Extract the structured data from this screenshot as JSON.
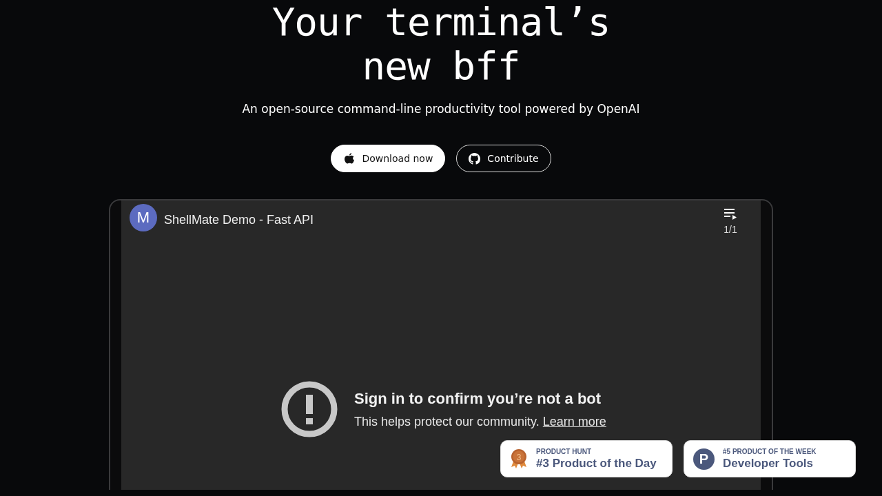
{
  "hero": {
    "title_lines": [
      "Your terminal’s",
      "new bff"
    ],
    "subtitle": "An open-source command-line productivity tool powered by OpenAI"
  },
  "buttons": [
    {
      "kind": "primary",
      "label": "Download now"
    },
    {
      "kind": "outline",
      "label": "Contribute"
    }
  ],
  "video": {
    "avatar_letter": "M",
    "title": "ShellMate Demo - Fast API",
    "playlist_count": "1/1",
    "error_title": "Sign in to confirm you’re not a bot",
    "error_text": "This helps protect our community.",
    "error_link": "Learn more"
  },
  "badges": [
    {
      "kind": "medal",
      "medal_number": "3",
      "eyebrow": "PRODUCT HUNT",
      "title": "#3 Product of the Day"
    },
    {
      "kind": "logo",
      "logo_letter": "P",
      "eyebrow": "#5 PRODUCT OF THE WEEK",
      "title": "Developer Tools"
    }
  ]
}
